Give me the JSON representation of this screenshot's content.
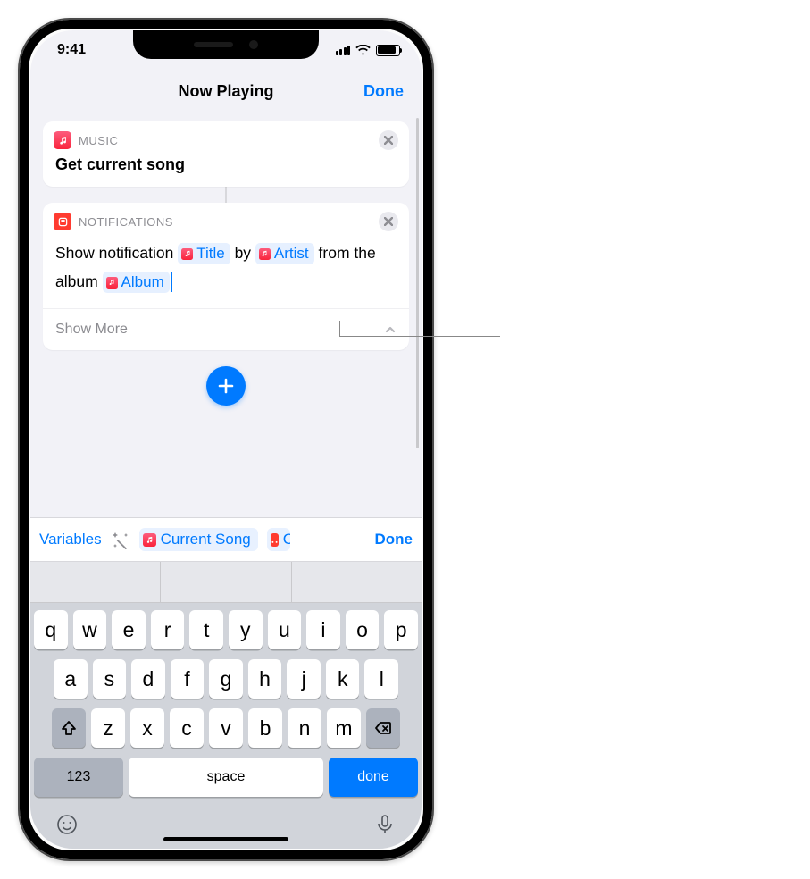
{
  "status": {
    "time": "9:41"
  },
  "nav": {
    "title": "Now Playing",
    "done": "Done"
  },
  "action_music": {
    "category_label": "MUSIC",
    "title": "Get current song"
  },
  "action_notif": {
    "category_label": "NOTIFICATIONS",
    "prefix": "Show notification",
    "token_title": "Title",
    "sep_by": "by",
    "token_artist": "Artist",
    "sep_from": "from the album",
    "token_album": "Album",
    "show_more": "Show More"
  },
  "var_bar": {
    "variables": "Variables",
    "current_song": "Current Song",
    "clipboard": "Clipboard",
    "done": "Done"
  },
  "keyboard": {
    "row1": [
      "q",
      "w",
      "e",
      "r",
      "t",
      "y",
      "u",
      "i",
      "o",
      "p"
    ],
    "row2": [
      "a",
      "s",
      "d",
      "f",
      "g",
      "h",
      "j",
      "k",
      "l"
    ],
    "row3": [
      "z",
      "x",
      "c",
      "v",
      "b",
      "n",
      "m"
    ],
    "num": "123",
    "space": "space",
    "return": "done"
  }
}
